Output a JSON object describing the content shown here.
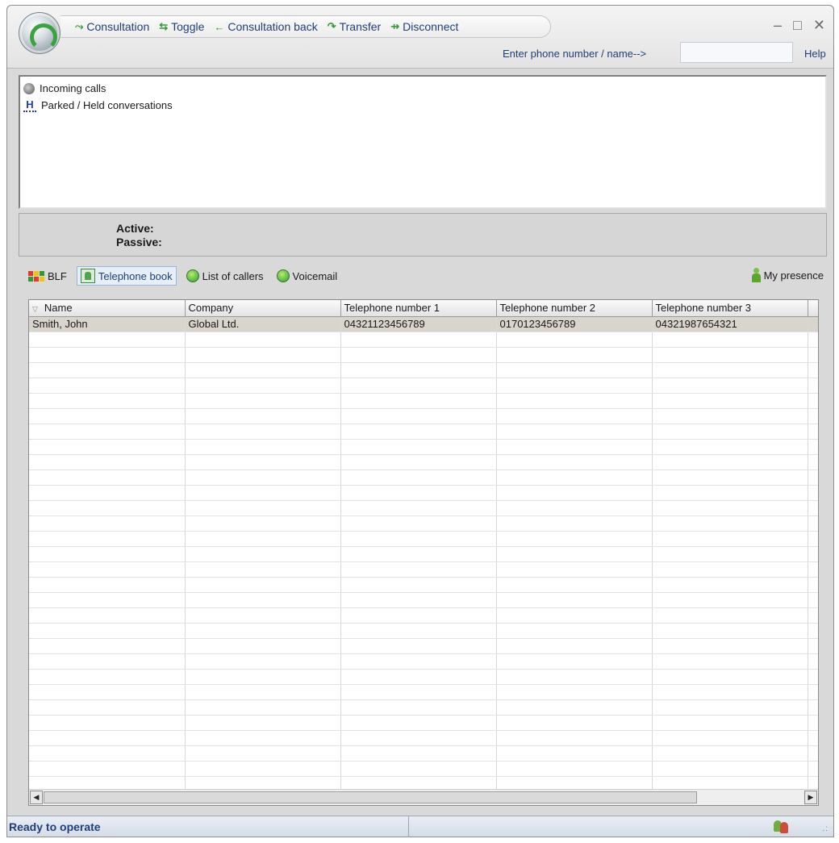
{
  "toolbar": {
    "consultation": "Consultation",
    "toggle": "Toggle",
    "consultation_back": "Consultation back",
    "transfer": "Transfer",
    "disconnect": "Disconnect"
  },
  "window_controls": {
    "minimize": "–",
    "maximize": "□",
    "close": "✕"
  },
  "search": {
    "label": "Enter phone number / name-->",
    "value": ""
  },
  "help": "Help",
  "calls": {
    "incoming": "Incoming calls",
    "parked": "Parked / Held conversations"
  },
  "status": {
    "active_label": "Active:",
    "passive_label": "Passive:"
  },
  "tabs": {
    "blf": "BLF",
    "telephone_book": "Telephone book",
    "list_of_callers": "List of callers",
    "voicemail": "Voicemail",
    "selected": "Telephone book"
  },
  "presence": "My presence",
  "table": {
    "columns": [
      "Name",
      "Company",
      "Telephone number 1",
      "Telephone number 2",
      "Telephone number 3"
    ],
    "rows": [
      [
        "Smith, John",
        "Global Ltd.",
        "04321123456789",
        "0170123456789",
        "04321987654321"
      ]
    ]
  },
  "statusbar": {
    "text": "Ready to operate"
  },
  "colors": {
    "accent": "#1f3f77",
    "selected_row": "#d9d4cc",
    "window_bg": "#d9d9d9"
  },
  "icons": [
    "app-orb-icon",
    "consultation-icon",
    "toggle-icon",
    "consultation-back-icon",
    "transfer-icon",
    "disconnect-icon",
    "phone-icon",
    "held-icon",
    "blf-icon",
    "telephone-book-icon",
    "list-of-callers-icon",
    "voicemail-icon",
    "presence-icon",
    "users-icon"
  ]
}
